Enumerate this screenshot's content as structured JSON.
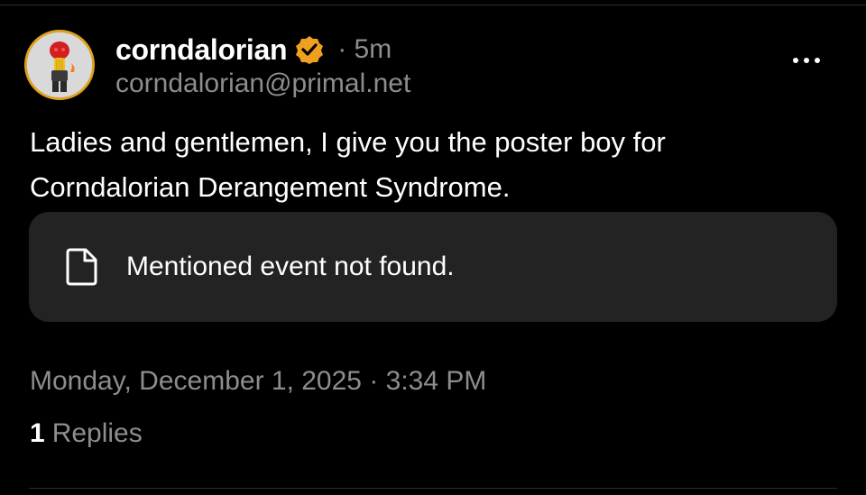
{
  "author": {
    "display_name": "corndalorian",
    "handle": "corndalorian@primal.net",
    "time_ago": "· 5m",
    "verified": true,
    "avatar_icon": "lego-figure-avatar",
    "avatar_ring_color": "#e0a020",
    "verified_color": "#f0a020"
  },
  "post": {
    "text": "Ladies and gentlemen, I give you the poster boy for Corndalorian Derangement Syndrome."
  },
  "mention_card": {
    "icon": "file-icon",
    "text": "Mentioned event not found."
  },
  "meta": {
    "timestamp": "Monday, December 1, 2025 · 3:34 PM",
    "reply_count": "1",
    "reply_label": "Replies"
  },
  "colors": {
    "background": "#000000",
    "card": "#232323",
    "secondary_text": "#8d8d8d"
  }
}
